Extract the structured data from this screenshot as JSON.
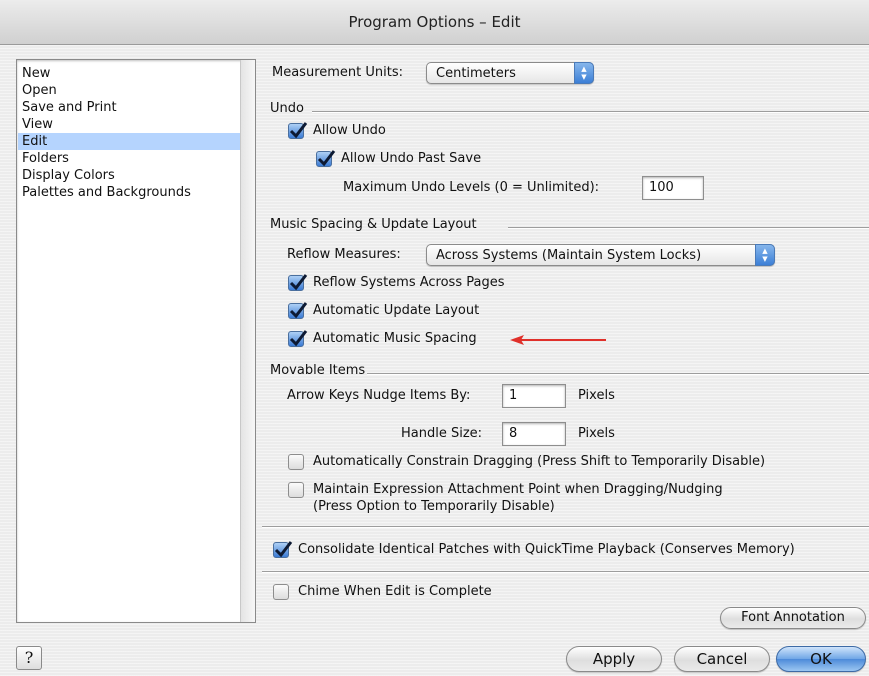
{
  "window": {
    "title": "Program Options – Edit"
  },
  "sidebar": {
    "items": [
      {
        "label": "New"
      },
      {
        "label": "Open"
      },
      {
        "label": "Save and Print"
      },
      {
        "label": "View"
      },
      {
        "label": "Edit",
        "selected": true
      },
      {
        "label": "Folders"
      },
      {
        "label": "Display Colors"
      },
      {
        "label": "Palettes and Backgrounds"
      }
    ]
  },
  "measurement": {
    "label": "Measurement Units:",
    "value": "Centimeters"
  },
  "undo": {
    "title": "Undo",
    "allow_undo": {
      "label": "Allow Undo",
      "checked": true
    },
    "allow_undo_past_save": {
      "label": "Allow Undo Past Save",
      "checked": true
    },
    "max_levels": {
      "label": "Maximum Undo Levels (0 = Unlimited):",
      "value": "100"
    }
  },
  "spacing": {
    "title": "Music Spacing & Update Layout",
    "reflow_label": "Reflow Measures:",
    "reflow_value": "Across Systems (Maintain System Locks)",
    "reflow_systems": {
      "label": "Reflow Systems Across Pages",
      "checked": true
    },
    "auto_update": {
      "label": "Automatic Update Layout",
      "checked": true
    },
    "auto_spacing": {
      "label": "Automatic Music Spacing",
      "checked": true
    }
  },
  "movable": {
    "title": "Movable Items",
    "nudge_label": "Arrow Keys Nudge Items By:",
    "nudge_value": "1",
    "nudge_unit": "Pixels",
    "handle_label": "Handle Size:",
    "handle_value": "8",
    "handle_unit": "Pixels",
    "constrain": {
      "label": "Automatically Constrain Dragging (Press Shift to Temporarily Disable)",
      "checked": false
    },
    "maintain_line1": "Maintain Expression Attachment Point when Dragging/Nudging",
    "maintain_line2": "(Press Option to Temporarily Disable)",
    "maintain_checked": false
  },
  "consolidate": {
    "label": "Consolidate Identical Patches with QuickTime Playback (Conserves Memory)",
    "checked": true
  },
  "chime": {
    "label": "Chime When Edit is Complete",
    "checked": false
  },
  "buttons": {
    "font_annotation": "Font Annotation",
    "apply": "Apply",
    "cancel": "Cancel",
    "ok": "OK",
    "help": "?"
  },
  "colors": {
    "arrow": "#e0302a",
    "selection": "#b5d4fe",
    "check_blue": "#3b7bd4"
  }
}
